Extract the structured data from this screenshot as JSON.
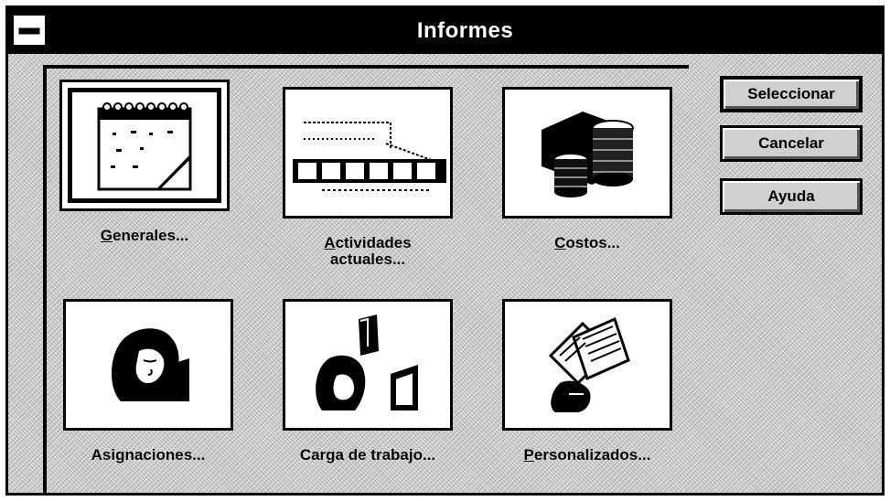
{
  "window": {
    "title": "Informes"
  },
  "tiles": [
    {
      "label": "Generales...",
      "accel": "G",
      "icon": "calendar-icon"
    },
    {
      "label": "Actividades actuales...",
      "accel": "A",
      "icon": "gantt-icon"
    },
    {
      "label": "Costos...",
      "accel": "C",
      "icon": "coins-icon"
    },
    {
      "label": "Asignaciones...",
      "accel": "",
      "icon": "person-icon"
    },
    {
      "label": "Carga de trabajo...",
      "accel": "",
      "icon": "workload-icon"
    },
    {
      "label": "Personalizados...",
      "accel": "P",
      "icon": "documents-hand-icon"
    }
  ],
  "buttons": {
    "select": "Seleccionar",
    "cancel": "Cancelar",
    "help": "Ayuda"
  }
}
